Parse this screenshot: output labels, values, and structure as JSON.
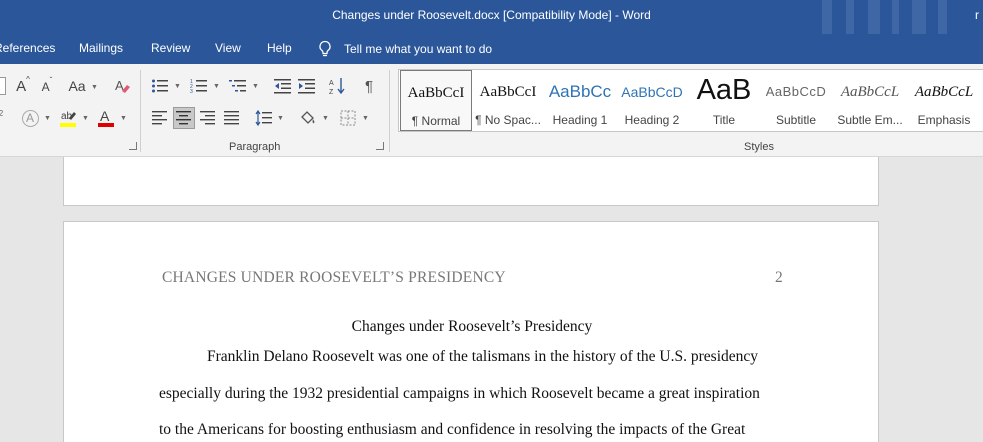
{
  "window": {
    "title": "Changes under Roosevelt.docx [Compatibility Mode]  -  Word",
    "user_initial": "r"
  },
  "tabs": [
    {
      "label": "References"
    },
    {
      "label": "Mailings"
    },
    {
      "label": "Review"
    },
    {
      "label": "View"
    },
    {
      "label": "Help"
    }
  ],
  "tell_me": {
    "label": "Tell me what you want to do",
    "icon": "lightbulb-icon"
  },
  "ribbon": {
    "font_group": {
      "grow_font": "A",
      "shrink_font": "A",
      "change_case": "Aa",
      "text_effects": "A",
      "font_color": "A",
      "highlight_color": "#ffff00",
      "font_color_value": "#e00000"
    },
    "paragraph_group": {
      "label": "Paragraph",
      "pilcrow": "¶"
    },
    "styles_group": {
      "label": "Styles",
      "items": [
        {
          "preview": "AaBbCcI",
          "name": "¶ Normal",
          "selected": true
        },
        {
          "preview": "AaBbCcI",
          "name": "¶ No Spac..."
        },
        {
          "preview": "AaBbCc",
          "name": "Heading 1"
        },
        {
          "preview": "AaBbCcD",
          "name": "Heading 2"
        },
        {
          "preview": "AaB",
          "name": "Title"
        },
        {
          "preview": "AaBbCcD",
          "name": "Subtitle"
        },
        {
          "preview": "AaBbCcL",
          "name": "Subtle Em..."
        },
        {
          "preview": "AaBbCcL",
          "name": "Emphasis"
        }
      ]
    }
  },
  "document": {
    "running_head": "CHANGES UNDER ROOSEVELT’S PRESIDENCY",
    "page_number": "2",
    "title": "Changes under Roosevelt’s Presidency",
    "lines": [
      "Franklin Delano Roosevelt was one of the talismans in the history of the U.S. presidency",
      "especially during the 1932 presidential campaigns in which Roosevelt became a great inspiration",
      "to the Americans for boosting enthusiasm and confidence in resolving the impacts of the Great"
    ]
  }
}
